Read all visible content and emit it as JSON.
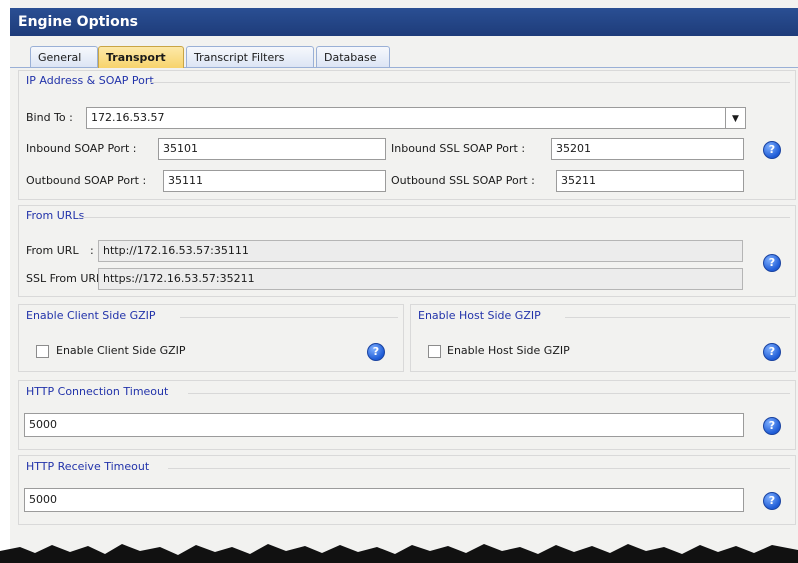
{
  "window": {
    "title": "Engine Options"
  },
  "tabs": [
    {
      "label": "General"
    },
    {
      "label": "Transport"
    },
    {
      "label": "Transcript Filters"
    },
    {
      "label": "Database"
    }
  ],
  "ip_section": {
    "title": "IP Address & SOAP Port",
    "bind_to_label": "Bind To :",
    "bind_to_value": "172.16.53.57",
    "inbound_label": "Inbound SOAP Port :",
    "inbound_value": "35101",
    "outbound_label": "Outbound SOAP Port :",
    "outbound_value": "35111",
    "inbound_ssl_label": "Inbound SSL SOAP Port :",
    "inbound_ssl_value": "35201",
    "outbound_ssl_label": "Outbound SSL SOAP Port :",
    "outbound_ssl_value": "35211"
  },
  "from_urls": {
    "title": "From URLs",
    "from_url_label": "From URL",
    "from_url_sep": ":",
    "from_url_value": "http://172.16.53.57:35111",
    "ssl_from_url_label": "SSL From URL :",
    "ssl_from_url_value": "https://172.16.53.57:35211"
  },
  "client_gzip": {
    "title": "Enable Client Side GZIP",
    "checkbox_label": "Enable Client Side GZIP"
  },
  "host_gzip": {
    "title": "Enable Host Side GZIP",
    "checkbox_label": "Enable Host Side GZIP"
  },
  "http_connection": {
    "title": "HTTP Connection Timeout",
    "value": "5000"
  },
  "http_receive": {
    "title": "HTTP Receive Timeout",
    "value": "5000"
  },
  "help": {
    "glyph": "?"
  },
  "dropdown": {
    "glyph": "▼"
  },
  "colors": {
    "title_bar": "#1e3c7a",
    "section_title": "#2233aa",
    "active_tab": "#f7d36c"
  }
}
